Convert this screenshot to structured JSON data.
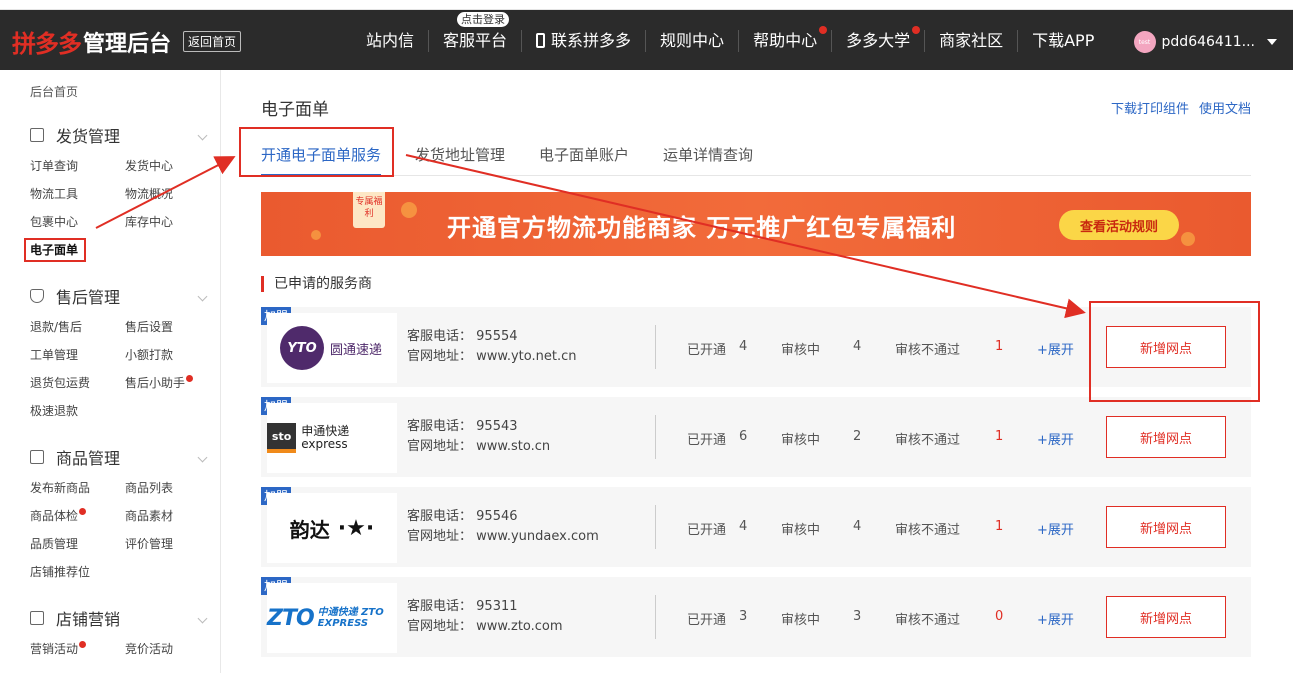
{
  "header": {
    "logo_brand": "拼多多",
    "logo_title": "管理后台",
    "back_home": "返回首页",
    "nav": [
      {
        "label": "站内信",
        "dot": false
      },
      {
        "label": "客服平台",
        "dot": false,
        "bubble": "点击登录"
      },
      {
        "label": "联系拼多多",
        "dot": false,
        "icon": "phone-icon"
      },
      {
        "label": "规则中心",
        "dot": false
      },
      {
        "label": "帮助中心",
        "dot": true
      },
      {
        "label": "多多大学",
        "dot": true
      },
      {
        "label": "商家社区",
        "dot": false
      },
      {
        "label": "下载APP",
        "dot": false
      }
    ],
    "user": {
      "avatar_text": "test",
      "name": "pdd646411..."
    }
  },
  "sidebar": {
    "home": "后台首页",
    "sections": [
      {
        "title": "发货管理",
        "icon": "document-icon",
        "items": [
          "订单查询",
          "发货中心",
          "物流工具",
          "物流概况",
          "包裹中心",
          "库存中心",
          "电子面单"
        ],
        "active": "电子面单",
        "dots": []
      },
      {
        "title": "售后管理",
        "icon": "shield-icon",
        "items": [
          "退款/售后",
          "售后设置",
          "工单管理",
          "小额打款",
          "退货包运费",
          "售后小助手",
          "极速退款"
        ],
        "dots": [
          "售后小助手"
        ]
      },
      {
        "title": "商品管理",
        "icon": "bag-icon",
        "items": [
          "发布新商品",
          "商品列表",
          "商品体检",
          "商品素材",
          "品质管理",
          "评价管理",
          "店铺推荐位"
        ],
        "dots": [
          "商品体检"
        ]
      },
      {
        "title": "店铺营销",
        "icon": "gift-icon",
        "items": [
          "营销活动",
          "竞价活动"
        ],
        "dots": [
          "营销活动"
        ]
      }
    ]
  },
  "main": {
    "title": "电子面单",
    "top_links": [
      "下载打印组件",
      "使用文档"
    ],
    "tabs": [
      "开通电子面单服务",
      "发货地址管理",
      "电子面单账户",
      "运单详情查询"
    ],
    "active_tab": 0,
    "banner": {
      "tag": "专属福利",
      "text": "开通官方物流功能商家 万元推广红包专属福利",
      "button": "查看活动规则"
    },
    "section_title": "已申请的服务商",
    "labels": {
      "phone": "客服电话：",
      "site": "官网地址：",
      "opened": "已开通",
      "reviewing": "审核中",
      "rejected": "审核不通过",
      "expand": "+展开",
      "add": "新增网点",
      "join_tag": "加盟"
    },
    "providers": [
      {
        "logo": "YTO 圆通速递",
        "logo_mark": "YTO",
        "logo_text": "圆通速递",
        "phone": "95554",
        "site": "www.yto.net.cn",
        "opened": "4",
        "reviewing": "4",
        "rejected": "1"
      },
      {
        "logo": "sto 申通快递 express",
        "logo_mark": "sto",
        "logo_text": "申通快递 express",
        "phone": "95543",
        "site": "www.sto.cn",
        "opened": "6",
        "reviewing": "2",
        "rejected": "1"
      },
      {
        "logo": "韵达",
        "logo_mark": "韵达",
        "logo_text": "·★·",
        "phone": "95546",
        "site": "www.yundaex.com",
        "opened": "4",
        "reviewing": "4",
        "rejected": "1"
      },
      {
        "logo": "ZTO 中通快递",
        "logo_mark": "ZTO",
        "logo_text": "中通快递 ZTO EXPRESS",
        "phone": "95311",
        "site": "www.zto.com",
        "opened": "3",
        "reviewing": "3",
        "rejected": "0"
      }
    ]
  },
  "colors": {
    "brand_red": "#e02e24",
    "link_blue": "#2c67c5",
    "topbar": "#2b2b2b"
  }
}
